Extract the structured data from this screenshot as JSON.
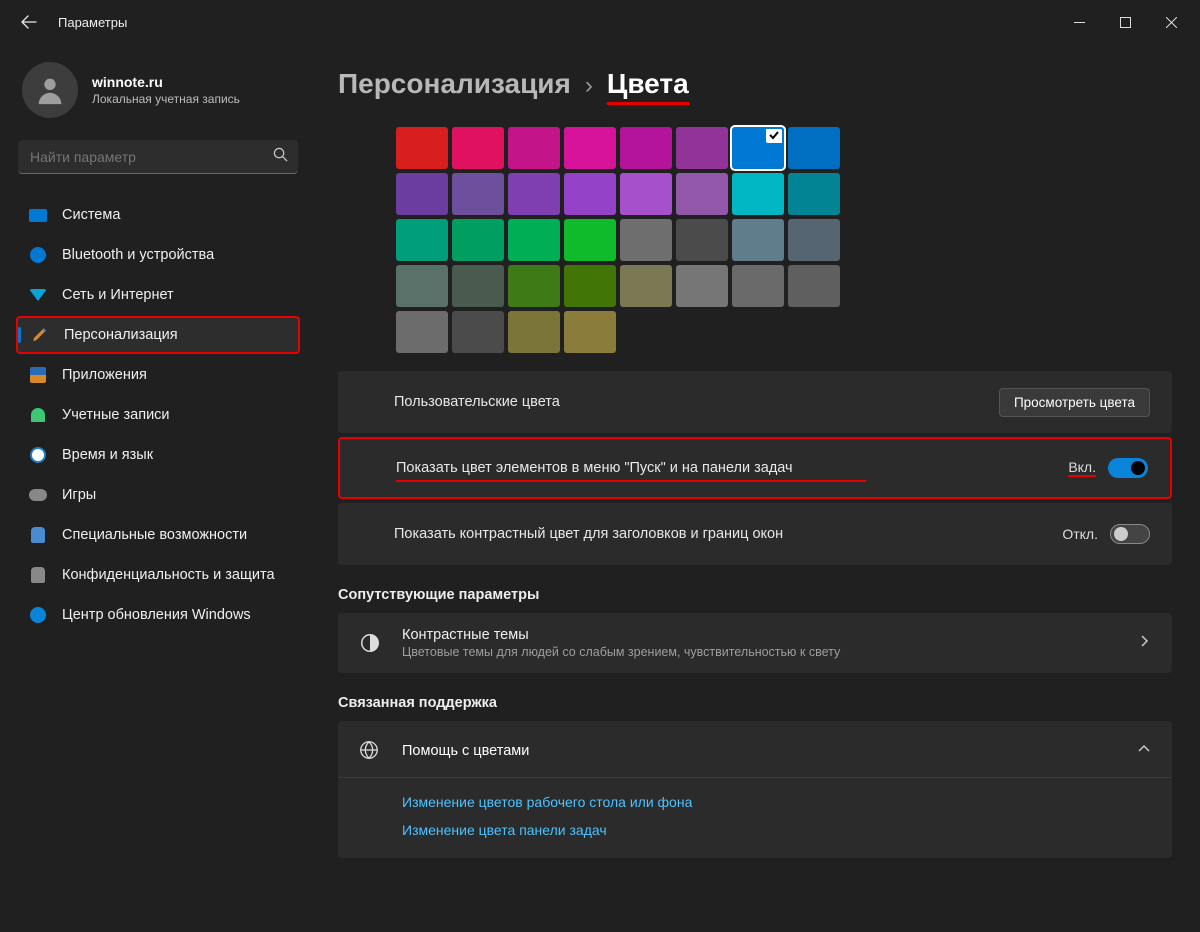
{
  "window": {
    "title": "Параметры"
  },
  "account": {
    "name": "winnote.ru",
    "type": "Локальная учетная запись"
  },
  "search": {
    "placeholder": "Найти параметр"
  },
  "nav": {
    "items": [
      {
        "label": "Система"
      },
      {
        "label": "Bluetooth и устройства"
      },
      {
        "label": "Сеть и Интернет"
      },
      {
        "label": "Персонализация"
      },
      {
        "label": "Приложения"
      },
      {
        "label": "Учетные записи"
      },
      {
        "label": "Время и язык"
      },
      {
        "label": "Игры"
      },
      {
        "label": "Специальные возможности"
      },
      {
        "label": "Конфиденциальность и защита"
      },
      {
        "label": "Центр обновления Windows"
      }
    ]
  },
  "breadcrumb": {
    "parent": "Персонализация",
    "sep": "›",
    "current": "Цвета"
  },
  "colors": {
    "accent_swatches": [
      "#d91e1e",
      "#e0115f",
      "#c31489",
      "#d6139a",
      "#b3149a",
      "#913399",
      "#0078d4",
      "#006fc1",
      "#6b3da0",
      "#6e4f9e",
      "#7f3fb1",
      "#9443c9",
      "#a750cc",
      "#9257a8",
      "#00b7c3",
      "#038494",
      "#009e7a",
      "#009e60",
      "#00ae56",
      "#0fbb2b",
      "#6e6e6e",
      "#4b4b4b",
      "#607d8b",
      "#556672",
      "#5a716a",
      "#4b5a4f",
      "#3e7a15",
      "#417505",
      "#7a7954",
      "#767676",
      "#6a6a6a",
      "#5f5f5f",
      "#6c6c6c",
      "#4b4b4b",
      "#7b7538",
      "#8a7d3c"
    ],
    "selected_index": 6
  },
  "settings": {
    "custom_colors_label": "Пользовательские цвета",
    "view_colors_btn": "Просмотреть цвета",
    "show_start_taskbar_label": "Показать цвет элементов в меню \"Пуск\" и на панели задач",
    "show_start_taskbar_state": "Вкл.",
    "show_titlebars_label": "Показать контрастный цвет для заголовков и границ окон",
    "show_titlebars_state": "Откл."
  },
  "related": {
    "section": "Сопутствующие параметры",
    "contrast_title": "Контрастные темы",
    "contrast_sub": "Цветовые темы для людей со слабым зрением, чувствительностью к свету"
  },
  "support": {
    "section": "Связанная поддержка",
    "help_title": "Помощь с цветами",
    "links": [
      "Изменение цветов рабочего стола или фона",
      "Изменение цвета панели задач"
    ]
  }
}
